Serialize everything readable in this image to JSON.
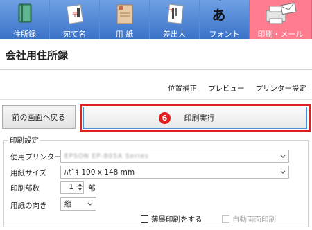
{
  "tabs": [
    {
      "label": "住所録",
      "icon": "address-book-icon"
    },
    {
      "label": "宛て名",
      "icon": "address-card-icon"
    },
    {
      "label": "用 紙",
      "icon": "paper-icon"
    },
    {
      "label": "差出人",
      "icon": "sender-card-icon"
    },
    {
      "label": "フォント",
      "icon": "font-icon",
      "glyph": "ぁあ"
    },
    {
      "label": "印刷・メール",
      "icon": "printer-mail-icon",
      "active": true
    }
  ],
  "page_title": "会社用住所録",
  "toplinks": {
    "position": "位置補正",
    "preview": "プレビュー",
    "printer_settings": "プリンター設定"
  },
  "back_button": "前の画面へ戻る",
  "execute_button": "印刷実行",
  "step_badge": "6",
  "print_settings": {
    "group_title": "印刷設定",
    "printer_label": "使用プリンター",
    "printer_value": "EPSON EP-805A Series",
    "paper_size_label": "用紙サイズ",
    "paper_size_value": "ﾊｶﾞｷ 100 x 148 mm",
    "copies_label": "印刷部数",
    "copies_value": "1",
    "copies_unit": "部",
    "orientation_label": "用紙の向き",
    "orientation_value": "縦",
    "thin_print_label": "薄墨印刷をする",
    "duplex_label": "自動両面印刷"
  },
  "colors": {
    "tabbar": "#3b73c8",
    "active_tab": "#ff7c8f",
    "highlight": "#e02020",
    "badge": "#e21e1e"
  }
}
